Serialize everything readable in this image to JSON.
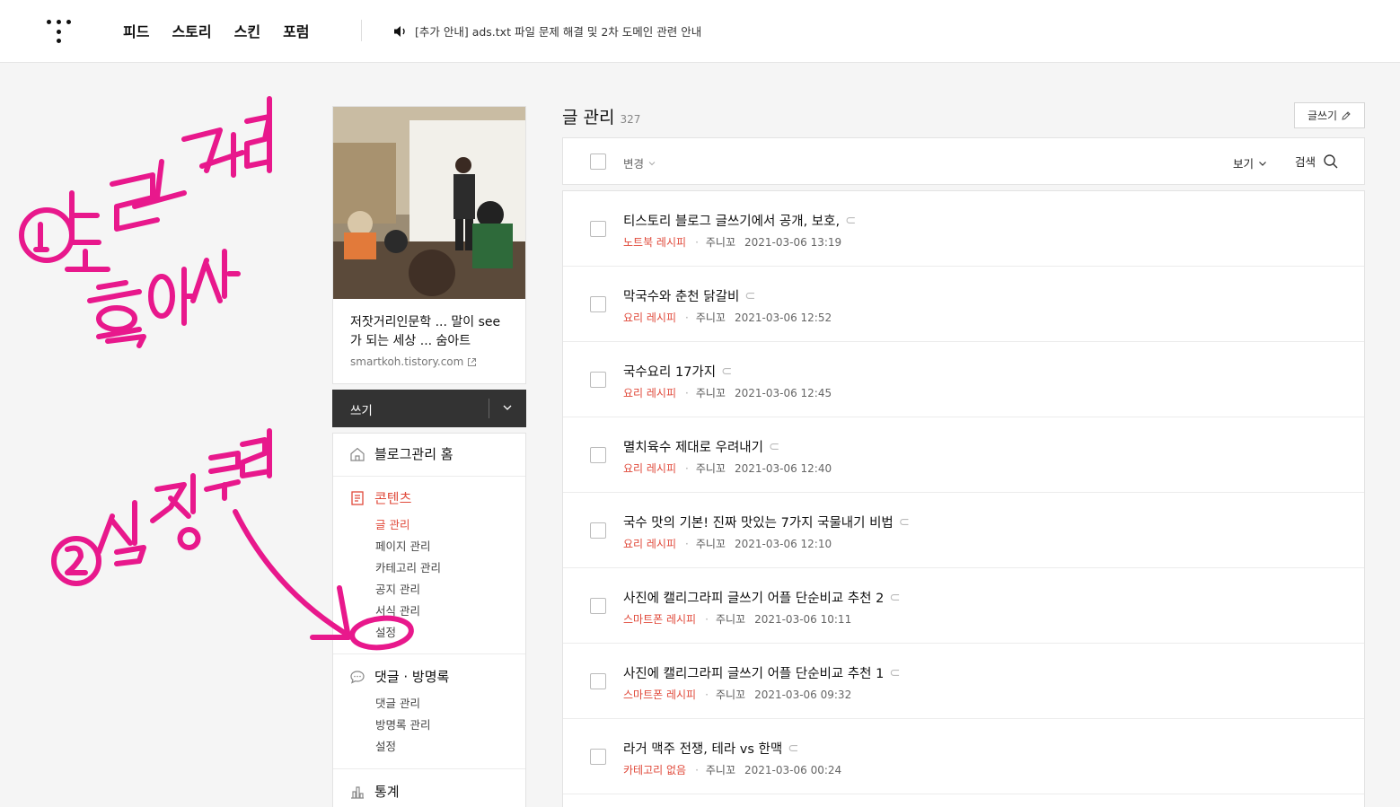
{
  "header": {
    "nav": [
      "피드",
      "스토리",
      "스킨",
      "포럼"
    ],
    "notice": "[추가 안내] ads.txt 파일 문제 해결 및 2차 도메인 관련 안내"
  },
  "blog": {
    "title": "저잣거리인문학 ... 말이 see가 되는 세상 ... 숨아트",
    "url": "smartkoh.tistory.com"
  },
  "sidebar": {
    "write_label": "쓰기",
    "home_label": "블로그관리 홈",
    "content_label": "콘텐츠",
    "content_items": [
      "글 관리",
      "페이지 관리",
      "카테고리 관리",
      "공지 관리",
      "서식 관리",
      "설정"
    ],
    "comments_label": "댓글 · 방명록",
    "comments_items": [
      "댓글 관리",
      "방명록 관리",
      "설정"
    ],
    "stats_label": "통계"
  },
  "main": {
    "title": "글 관리",
    "count": "327",
    "write_button": "글쓰기",
    "change_label": "변경",
    "view_label": "보기",
    "search_label": "검색",
    "posts": [
      {
        "title": "티스토리 블로그 글쓰기에서 공개, 보호,",
        "category": "노트북 레시피",
        "author": "주니꼬",
        "date": "2021-03-06 13:19"
      },
      {
        "title": "막국수와 춘천 닭갈비",
        "category": "요리 레시피",
        "author": "주니꼬",
        "date": "2021-03-06 12:52"
      },
      {
        "title": "국수요리 17가지",
        "category": "요리 레시피",
        "author": "주니꼬",
        "date": "2021-03-06 12:45"
      },
      {
        "title": "멸치육수 제대로 우려내기",
        "category": "요리 레시피",
        "author": "주니꼬",
        "date": "2021-03-06 12:40"
      },
      {
        "title": "국수 맛의 기본! 진짜 맛있는 7가지 국물내기 비법",
        "category": "요리 레시피",
        "author": "주니꼬",
        "date": "2021-03-06 12:10"
      },
      {
        "title": "사진에 캘리그라피 글쓰기 어플 단순비교 추천 2",
        "category": "스마트폰 레시피",
        "author": "주니꼬",
        "date": "2021-03-06 10:11"
      },
      {
        "title": "사진에 캘리그라피 글쓰기 어플 단순비교 추천 1",
        "category": "스마트폰 레시피",
        "author": "주니꼬",
        "date": "2021-03-06 09:32"
      },
      {
        "title": "라거 맥주 전쟁, 테라 vs 한맥",
        "category": "카테고리 없음",
        "author": "주니꼬",
        "date": "2021-03-06 00:24"
      }
    ]
  },
  "colors": {
    "accent": "#e0493a",
    "annotation": "#e8188c",
    "dark_bar": "#333333"
  }
}
